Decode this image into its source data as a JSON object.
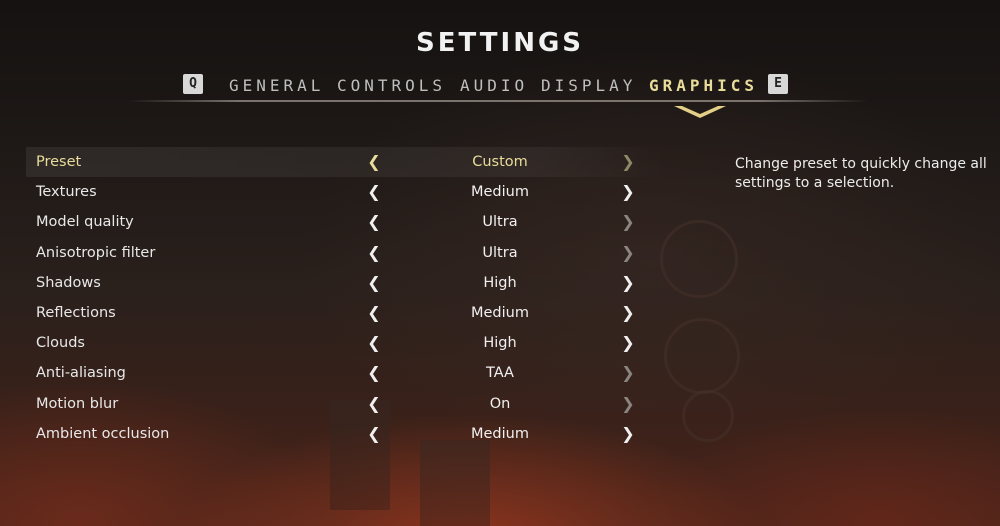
{
  "title": "SETTINGS",
  "tabbar": {
    "prev_key": "Q",
    "next_key": "E",
    "tabs": [
      {
        "label": "GENERAL",
        "active": false
      },
      {
        "label": "CONTROLS",
        "active": false
      },
      {
        "label": "AUDIO",
        "active": false
      },
      {
        "label": "DISPLAY",
        "active": false
      },
      {
        "label": "GRAPHICS",
        "active": true
      }
    ]
  },
  "settings": [
    {
      "label": "Preset",
      "value": "Custom",
      "selected": true,
      "right_enabled": false
    },
    {
      "label": "Textures",
      "value": "Medium",
      "selected": false,
      "right_enabled": true
    },
    {
      "label": "Model quality",
      "value": "Ultra",
      "selected": false,
      "right_enabled": false
    },
    {
      "label": "Anisotropic filter",
      "value": "Ultra",
      "selected": false,
      "right_enabled": false
    },
    {
      "label": "Shadows",
      "value": "High",
      "selected": false,
      "right_enabled": true
    },
    {
      "label": "Reflections",
      "value": "Medium",
      "selected": false,
      "right_enabled": true
    },
    {
      "label": "Clouds",
      "value": "High",
      "selected": false,
      "right_enabled": true
    },
    {
      "label": "Anti-aliasing",
      "value": "TAA",
      "selected": false,
      "right_enabled": false
    },
    {
      "label": "Motion blur",
      "value": "On",
      "selected": false,
      "right_enabled": false
    },
    {
      "label": "Ambient occlusion",
      "value": "Medium",
      "selected": false,
      "right_enabled": true
    }
  ],
  "description": "Change preset to quickly change all settings to a selection.",
  "icons": {
    "left_arrow": "chevron-left-icon",
    "right_arrow": "chevron-right-icon",
    "active_tab_marker": "chevron-down-icon"
  },
  "colors": {
    "accent": "#e9dc9a",
    "text": "#e8e8e8",
    "dim_arrow": "#8a8580"
  }
}
